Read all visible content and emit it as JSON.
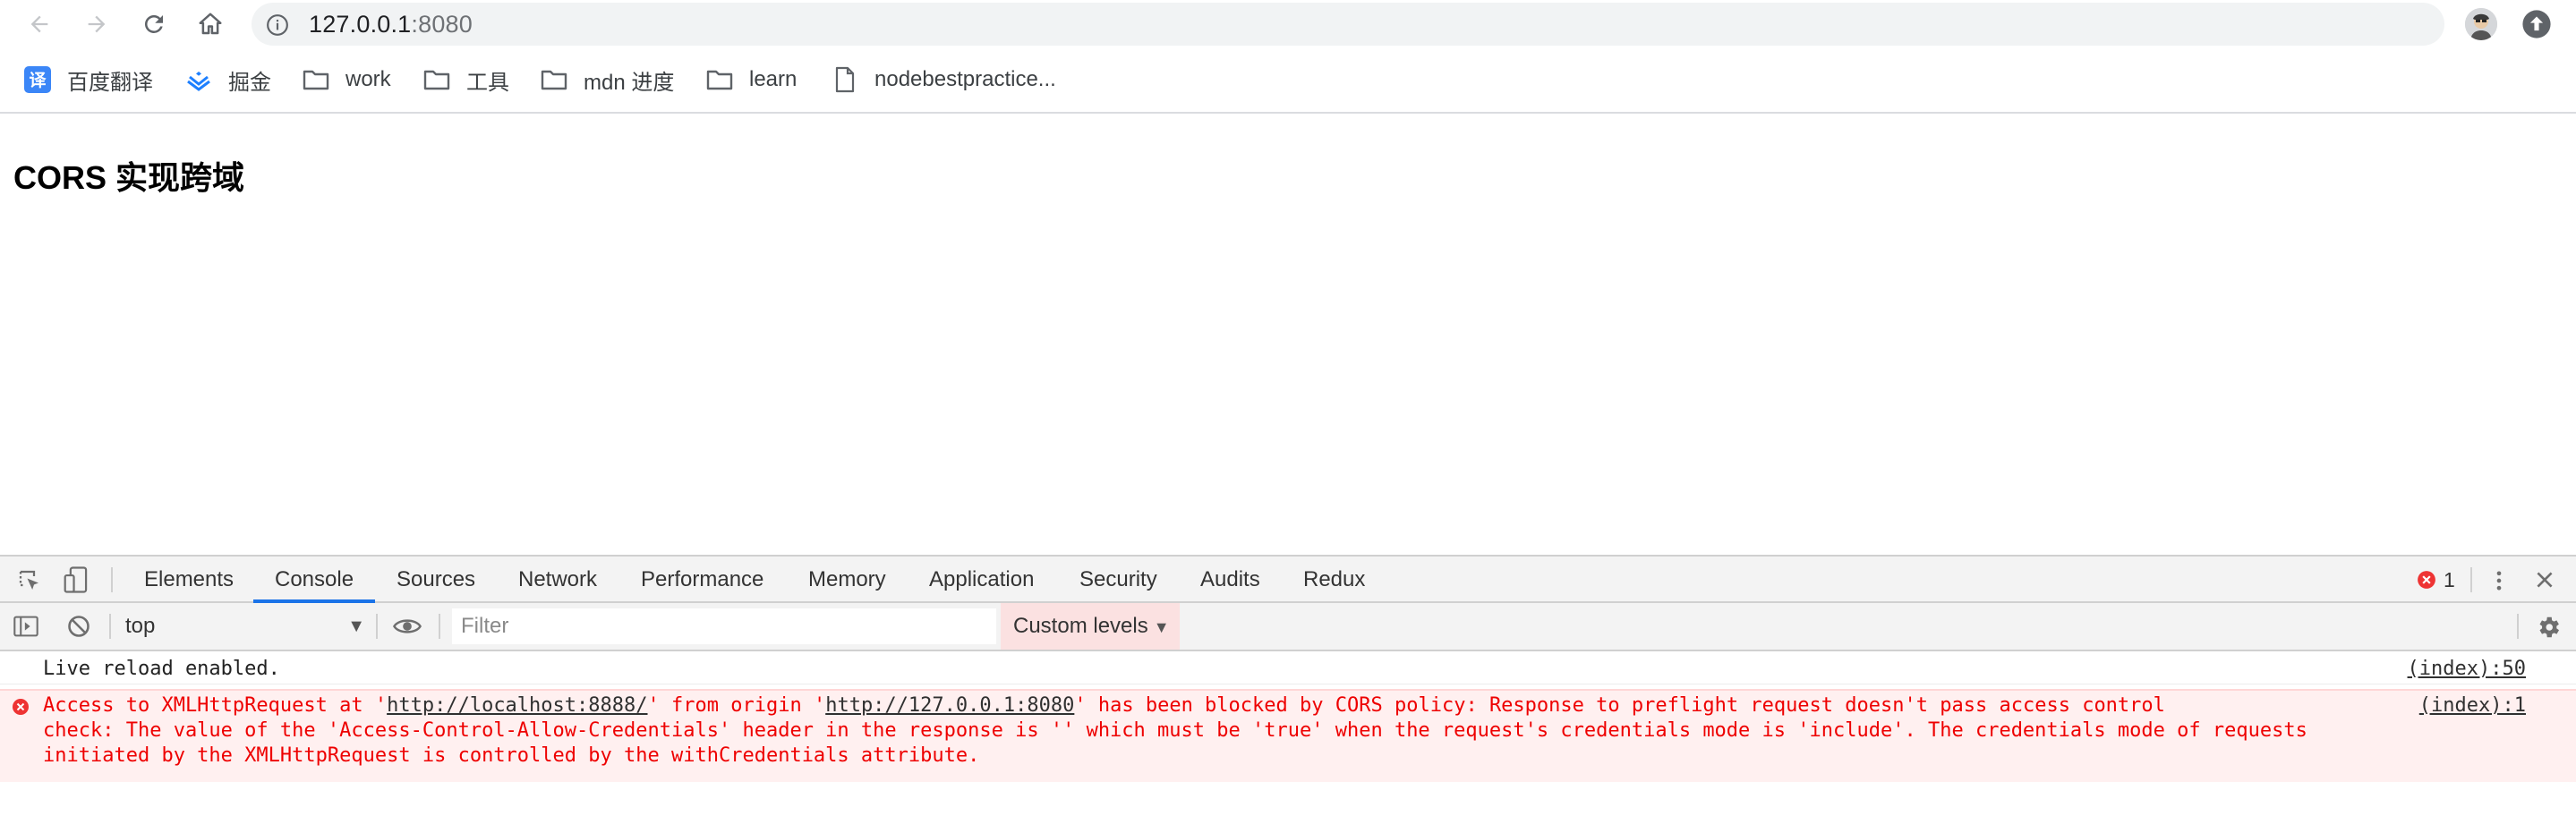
{
  "browser": {
    "url_host": "127.0.0.1",
    "url_port": ":8080",
    "icons": {
      "back": "arrow-left-icon",
      "forward": "arrow-right-icon",
      "reload": "reload-icon",
      "home": "home-icon",
      "info": "info-icon",
      "star": "star-icon",
      "profile": "avatar",
      "update": "arrow-up-circle-icon"
    }
  },
  "bookmarks": [
    {
      "label": "百度翻译",
      "icon": "translate-icon"
    },
    {
      "label": "掘金",
      "icon": "juejin-icon"
    },
    {
      "label": "work",
      "icon": "folder-icon"
    },
    {
      "label": "工具",
      "icon": "folder-icon"
    },
    {
      "label": "mdn 进度",
      "icon": "folder-icon"
    },
    {
      "label": "learn",
      "icon": "folder-icon"
    },
    {
      "label": "nodebestpractice...",
      "icon": "page-icon"
    }
  ],
  "page": {
    "title": "CORS 实现跨域"
  },
  "devtools": {
    "tabs": [
      "Elements",
      "Console",
      "Sources",
      "Network",
      "Performance",
      "Memory",
      "Application",
      "Security",
      "Audits",
      "Redux"
    ],
    "active_tab": "Console",
    "error_count": "1",
    "context": "top",
    "filter_placeholder": "Filter",
    "levels_label": "Custom levels",
    "colors": {
      "accent": "#1a73e8",
      "error": "#e00000",
      "error_bg": "#fff0f0"
    }
  },
  "console": {
    "log": {
      "text": "Live reload enabled.",
      "source": "(index):50"
    },
    "error": {
      "line1_a": "Access to XMLHttpRequest at '",
      "url1": "http://localhost:8888/",
      "line1_b": "' from origin '",
      "url2": "http://127.0.0.1:8080",
      "line1_c": "' has been blocked by CORS policy: Response to preflight request doesn't pass access control",
      "line2": "check: The value of the 'Access-Control-Allow-Credentials' header in the response is '' which must be 'true' when the request's credentials mode is 'include'. The credentials mode of requests",
      "line3": "initiated by the XMLHttpRequest is controlled by the withCredentials attribute.",
      "source": "(index):1"
    }
  }
}
